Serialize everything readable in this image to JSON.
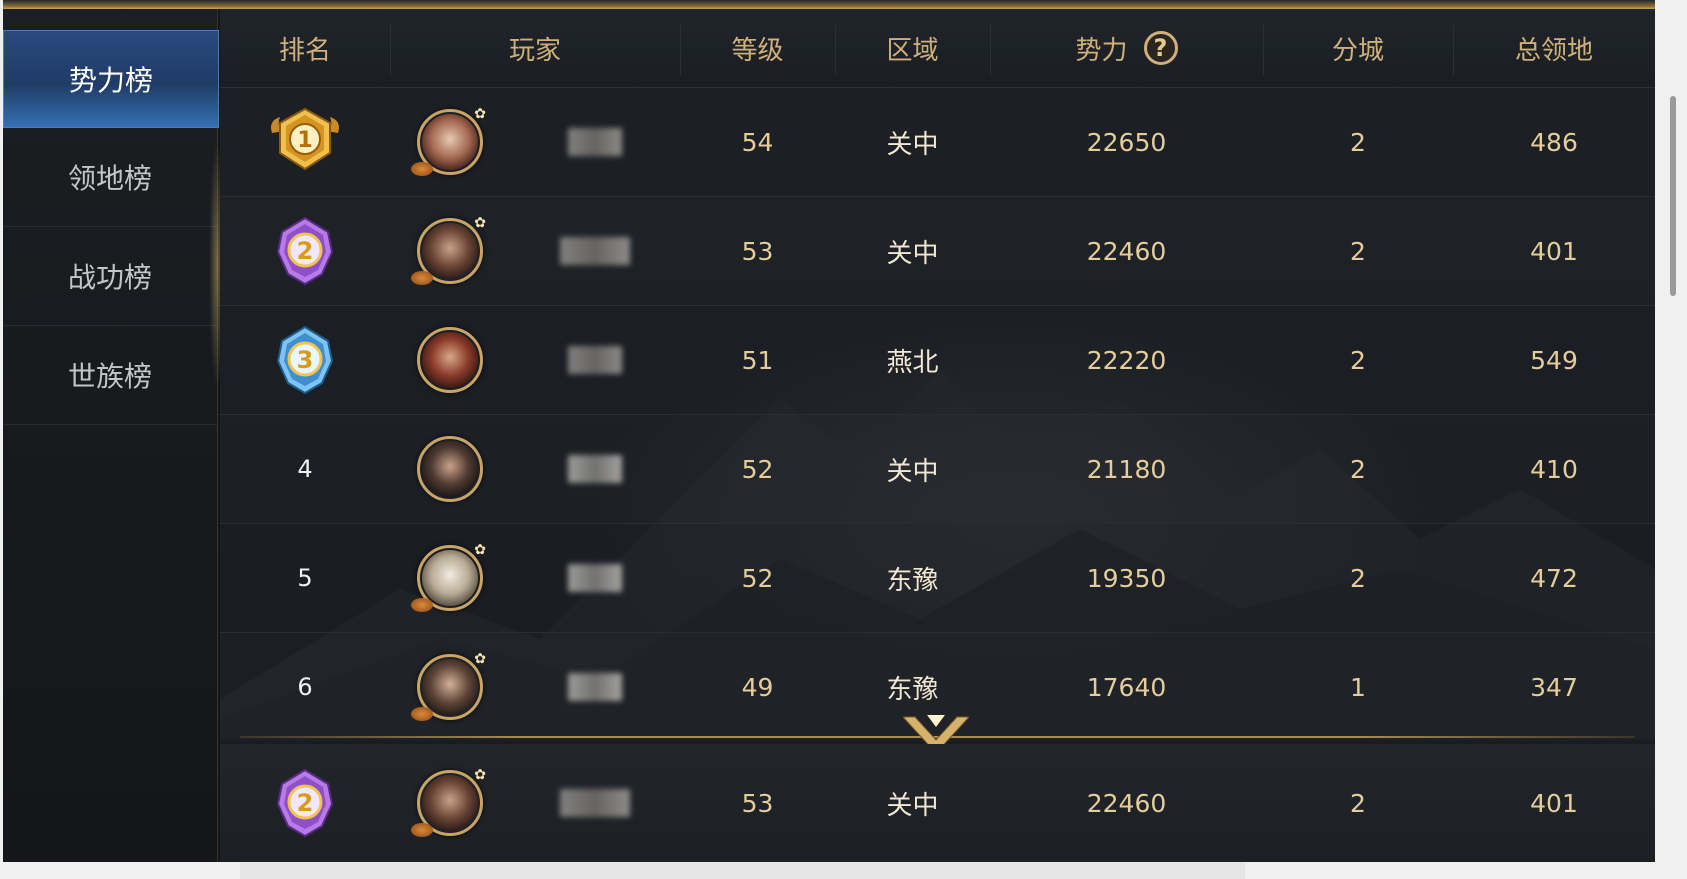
{
  "sidebar": {
    "items": [
      {
        "label": "势力榜",
        "active": true
      },
      {
        "label": "领地榜",
        "active": false
      },
      {
        "label": "战功榜",
        "active": false
      },
      {
        "label": "世族榜",
        "active": false
      }
    ]
  },
  "table": {
    "headers": {
      "rank": "排名",
      "player": "玩家",
      "level": "等级",
      "region": "区域",
      "power": "势力",
      "branch_cities": "分城",
      "total_territory": "总领地"
    },
    "help_icon": "?",
    "rows": [
      {
        "rank": "1",
        "medal": "gold",
        "level": "54",
        "region": "关中",
        "power": "22650",
        "branch_cities": "2",
        "total_territory": "486"
      },
      {
        "rank": "2",
        "medal": "purple",
        "level": "53",
        "region": "关中",
        "power": "22460",
        "branch_cities": "2",
        "total_territory": "401"
      },
      {
        "rank": "3",
        "medal": "blue",
        "level": "51",
        "region": "燕北",
        "power": "22220",
        "branch_cities": "2",
        "total_territory": "549"
      },
      {
        "rank": "4",
        "medal": "",
        "level": "52",
        "region": "关中",
        "power": "21180",
        "branch_cities": "2",
        "total_territory": "410"
      },
      {
        "rank": "5",
        "medal": "",
        "level": "52",
        "region": "东豫",
        "power": "19350",
        "branch_cities": "2",
        "total_territory": "472"
      },
      {
        "rank": "6",
        "medal": "",
        "level": "49",
        "region": "东豫",
        "power": "17640",
        "branch_cities": "1",
        "total_territory": "347"
      }
    ],
    "self_row": {
      "rank": "2",
      "medal": "purple",
      "level": "53",
      "region": "关中",
      "power": "22460",
      "branch_cities": "2",
      "total_territory": "401"
    }
  },
  "colors": {
    "header_text": "#cfb07a",
    "value_text": "#e4cd9b",
    "active_tab": "#2a4a7e",
    "gold_medal": "#e8b84a",
    "purple_medal": "#9b5fd0",
    "blue_medal": "#4aa0e6"
  },
  "icons": {
    "help": "question-mark-icon",
    "expand": "chevron-down-icon",
    "medal_gold": "rank-1-medal-icon",
    "medal_silver": "rank-2-medal-icon",
    "medal_bronze": "rank-3-medal-icon"
  }
}
